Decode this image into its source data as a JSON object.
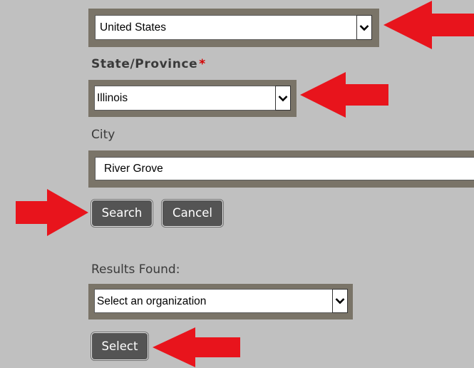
{
  "form": {
    "country": {
      "value": "United States"
    },
    "state": {
      "label": "State/Province",
      "required_mark": "*",
      "value": "Illinois"
    },
    "city": {
      "label": "City",
      "value": "River Grove"
    },
    "buttons": {
      "search": "Search",
      "cancel": "Cancel",
      "select": "Select"
    },
    "results": {
      "label": "Results Found:",
      "value": "Select an organization"
    }
  },
  "colors": {
    "background": "#c0c0c0",
    "frame": "#7a7468",
    "button": "#545454",
    "required": "#d40000",
    "annotation_arrow": "#e8141c"
  },
  "icons": {
    "dropdown": "chevron-down-icon",
    "annotation": "red-arrow-icon"
  }
}
